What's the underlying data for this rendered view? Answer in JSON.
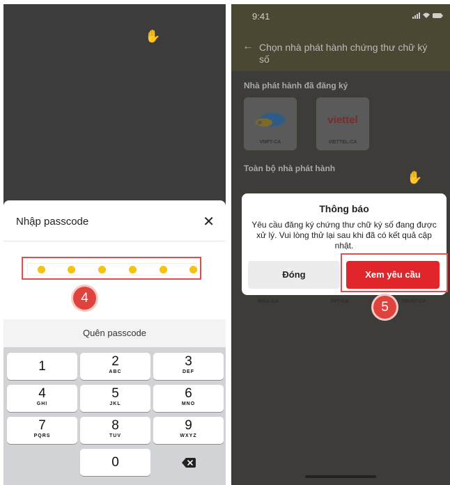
{
  "left": {
    "sheet_title": "Nhập passcode",
    "close_glyph": "✕",
    "passcode_dots_filled": 6,
    "step_badge": "4",
    "forgot_label": "Quên passcode",
    "keys": [
      {
        "num": "1",
        "letters": ""
      },
      {
        "num": "2",
        "letters": "ABC"
      },
      {
        "num": "3",
        "letters": "DEF"
      },
      {
        "num": "4",
        "letters": "GHI"
      },
      {
        "num": "5",
        "letters": "JKL"
      },
      {
        "num": "6",
        "letters": "MNO"
      },
      {
        "num": "7",
        "letters": "PQRS"
      },
      {
        "num": "8",
        "letters": "TUV"
      },
      {
        "num": "9",
        "letters": "WXYZ"
      },
      {
        "num": "0",
        "letters": ""
      }
    ],
    "backspace_icon": "backspace-icon"
  },
  "right": {
    "status_time": "9:41",
    "status_icons": "signal-icon wifi-icon battery-icon",
    "header_title": "Chọn nhà phát hành chứng thư chữ ký số",
    "registered_label": "Nhà phát hành đã đăng ký",
    "issuers": [
      {
        "name": "VNPT-CA",
        "logo": "vnpt-cloud-logo"
      },
      {
        "name": "VIETTEL-CA",
        "logo_text": "viettel"
      }
    ],
    "all_label": "Toàn bộ nhà phát hành",
    "faded_names": [
      "MISA-CA",
      "FPT-CA",
      "TRUST-CA"
    ],
    "dialog": {
      "title": "Thông báo",
      "message": "Yêu cầu đăng ký chứng thư chữ ký số đang được xử lý. Vui lòng thử lại sau khi đã có kết quả cập nhật.",
      "close_label": "Đóng",
      "view_label": "Xem yêu cầu"
    },
    "step_badge": "5"
  },
  "colors": {
    "accent_red": "#e0262a",
    "dot_yellow": "#f2c310",
    "highlight_red": "#e14c4c"
  }
}
